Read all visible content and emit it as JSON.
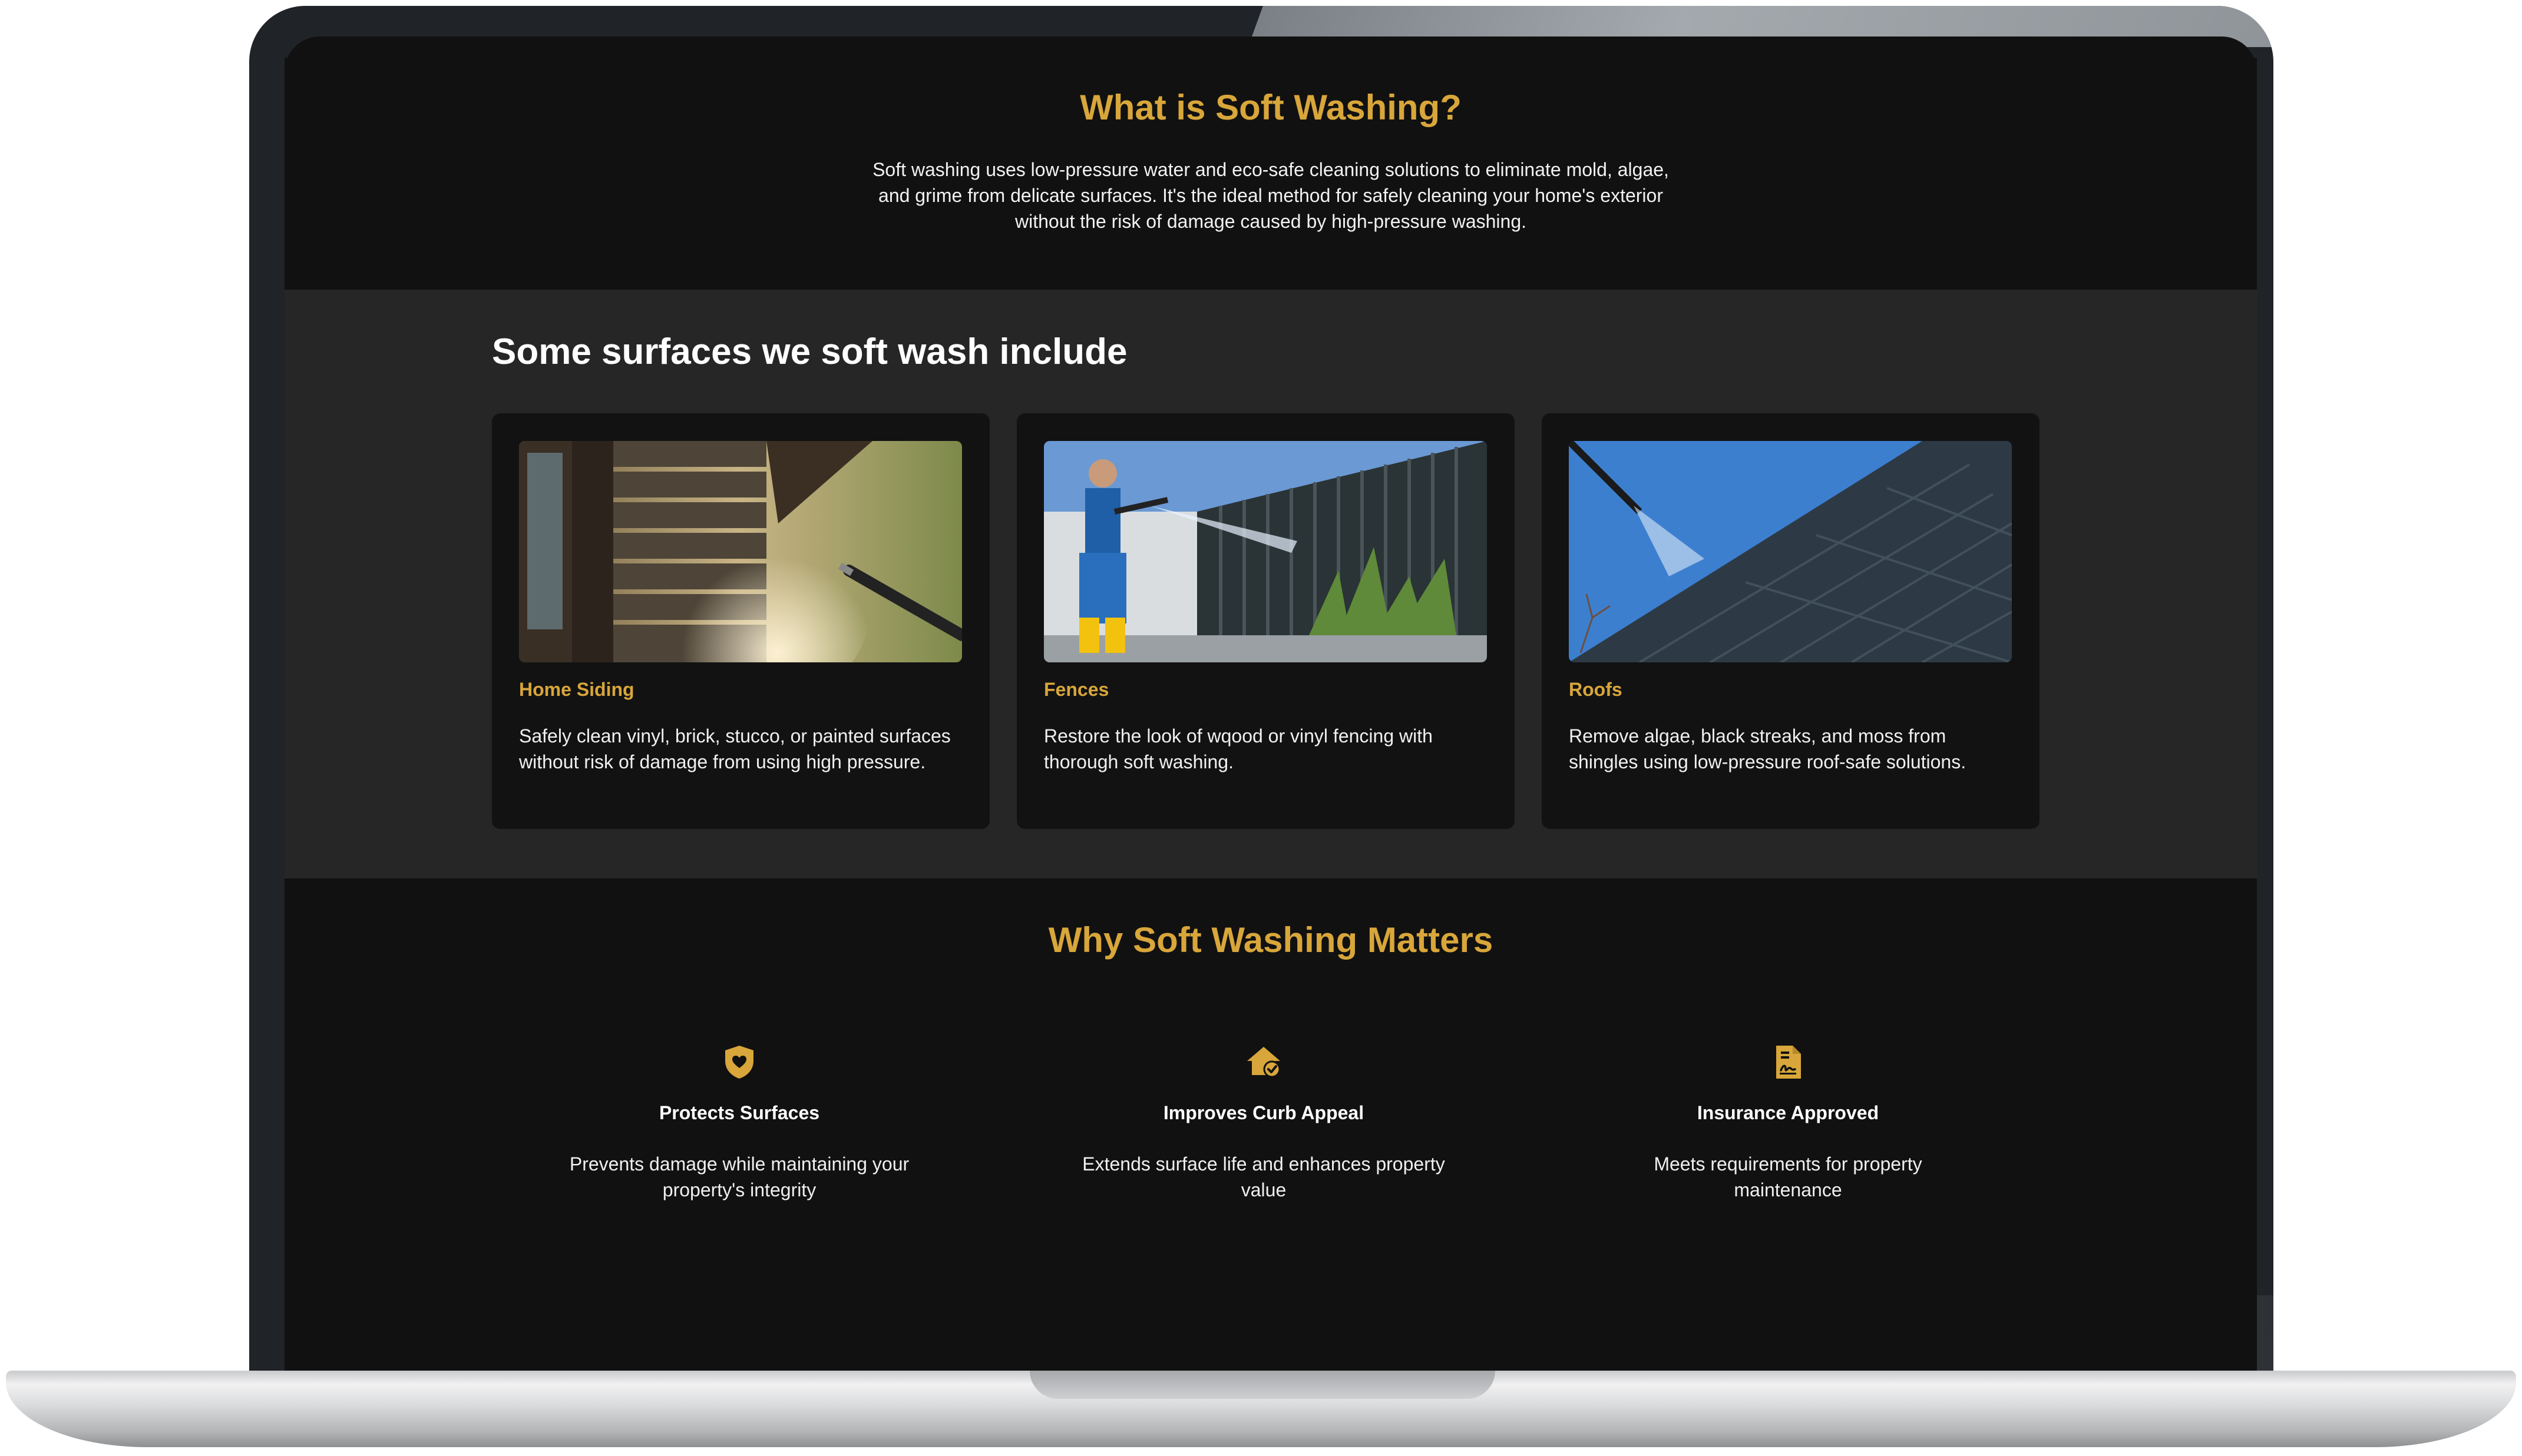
{
  "intro_section": {
    "title": "What is Soft Washing?",
    "description": "Soft washing uses low-pressure water and eco-safe cleaning solutions to eliminate mold, algae, and grime from delicate surfaces. It's the ideal method for safely cleaning your home's exterior without the risk of damage caused by high-pressure washing."
  },
  "surfaces_section": {
    "title": "Some surfaces we soft wash include",
    "cards": [
      {
        "title": "Home Siding",
        "text": "Safely clean vinyl, brick, stucco, or painted surfaces without risk of damage from using high pressure."
      },
      {
        "title": "Fences",
        "text": "Restore the look of wqood or vinyl fencing with thorough soft washing."
      },
      {
        "title": "Roofs",
        "text": "Remove algae, black streaks, and moss from shingles using low-pressure roof-safe solutions."
      }
    ]
  },
  "why_section": {
    "title": "Why Soft Washing Matters",
    "features": [
      {
        "icon": "shield-heart-icon",
        "title": "Protects Surfaces",
        "text": "Prevents damage while maintaining your property's integrity"
      },
      {
        "icon": "house-check-icon",
        "title": "Improves Curb Appeal",
        "text": "Extends surface life and enhances property value"
      },
      {
        "icon": "document-signature-icon",
        "title": "Insurance Approved",
        "text": "Meets requirements for property maintenance"
      }
    ]
  },
  "colors": {
    "accent": "#d8a63a",
    "background": "#111111",
    "section_alt": "#262626",
    "card": "#121212"
  }
}
